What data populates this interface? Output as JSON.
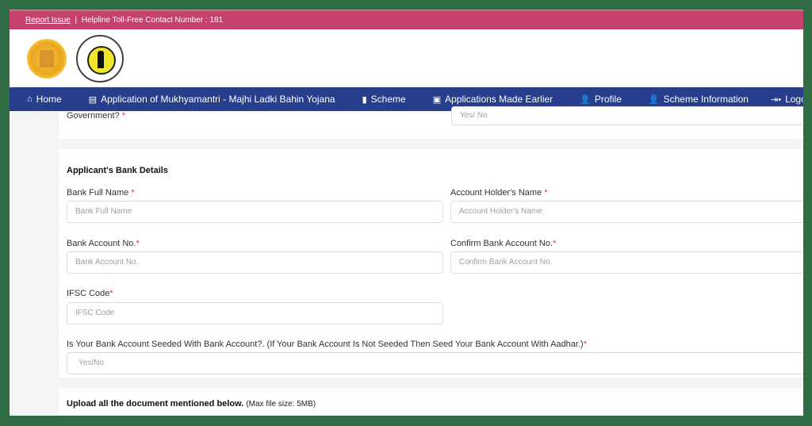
{
  "topbar": {
    "report_issue": "Report Issue",
    "separator": "|",
    "helpline": "Helpline Toll-Free Contact Number : 181",
    "color": "#c4426c"
  },
  "logos": [
    {
      "name": "maharashtra-govt-seal"
    },
    {
      "name": "women-child-development-logo"
    }
  ],
  "navbar": {
    "color": "#263e8c",
    "items": [
      {
        "icon": "home-icon",
        "glyph": "⌂",
        "label": "Home"
      },
      {
        "icon": "document-icon",
        "glyph": "▤",
        "label": "Application of Mukhyamantri - Majhi Ladki Bahin Yojana"
      },
      {
        "icon": "document-icon",
        "glyph": "▮",
        "label": "Scheme"
      },
      {
        "icon": "list-icon",
        "glyph": "▣",
        "label": "Applications Made Earlier"
      },
      {
        "icon": "user-icon",
        "glyph": "👤",
        "label": "Profile"
      },
      {
        "icon": "user-icon",
        "glyph": "👤",
        "label": "Scheme Information"
      },
      {
        "icon": "logout-icon",
        "glyph": "⇥•",
        "label": "Logout"
      }
    ]
  },
  "previous_section": {
    "label_tail": "Government?",
    "required": "*",
    "select_placeholder": "Yes/ No"
  },
  "bank_details": {
    "title": "Applicant's Bank Details",
    "fields": {
      "bank_full_name": {
        "label": "Bank Full Name",
        "required": "*",
        "placeholder": "Bank Full Name"
      },
      "account_holder_name": {
        "label": "Account Holder's Name",
        "required": "*",
        "placeholder": "Account Holder's Name"
      },
      "bank_account_no": {
        "label": "Bank Account No.",
        "required": "*",
        "placeholder": "Bank Account No."
      },
      "confirm_bank_account_no": {
        "label": "Confirm Bank Account No.",
        "required": "*",
        "placeholder": "Confirm Bank Account No."
      },
      "ifsc_code": {
        "label": "IFSC Code",
        "required": "*",
        "placeholder": "IFSC Code"
      },
      "aadhar_seeded": {
        "label": "Is Your Bank Account Seeded With Bank Account?. (If Your Bank Account Is Not Seeded Then Seed Your Bank Account With Aadhar.)",
        "required": "*",
        "placeholder": "Yes/No"
      }
    }
  },
  "upload": {
    "title": "Upload all the document mentioned below.",
    "note": "(Max file size: 5MB)"
  }
}
